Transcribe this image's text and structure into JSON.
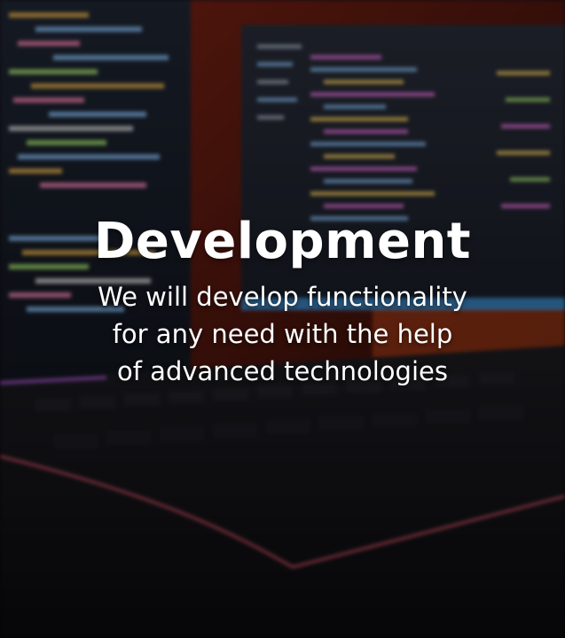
{
  "hero": {
    "title": "Development",
    "subtitle": "We will develop functionality for any need with the help of advanced technologies"
  },
  "background": {
    "description_icon": "code-monitors-keyboard-photo"
  }
}
